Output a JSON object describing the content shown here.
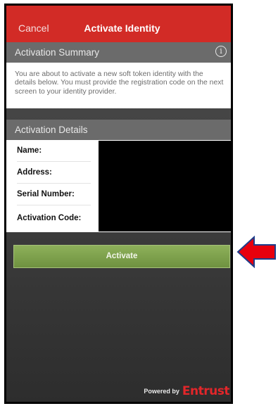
{
  "navbar": {
    "cancel_label": "Cancel",
    "title": "Activate Identity"
  },
  "summary": {
    "header": "Activation Summary",
    "info_icon": "info-circle-icon",
    "text": "You are about to activate a new soft token identity with the details below. You must provide the registration code on the next screen to your identity provider."
  },
  "details": {
    "header": "Activation Details",
    "fields": [
      {
        "label": "Name:"
      },
      {
        "label": "Address:"
      },
      {
        "label": "Serial Number:"
      },
      {
        "label": "Activation Code:"
      }
    ]
  },
  "activate_button": "Activate",
  "footer": {
    "powered_by": "Powered by",
    "brand": "Entrust"
  },
  "colors": {
    "navbar": "#d22b26",
    "button": "#7a9c48",
    "arrow": "#e8000d"
  }
}
